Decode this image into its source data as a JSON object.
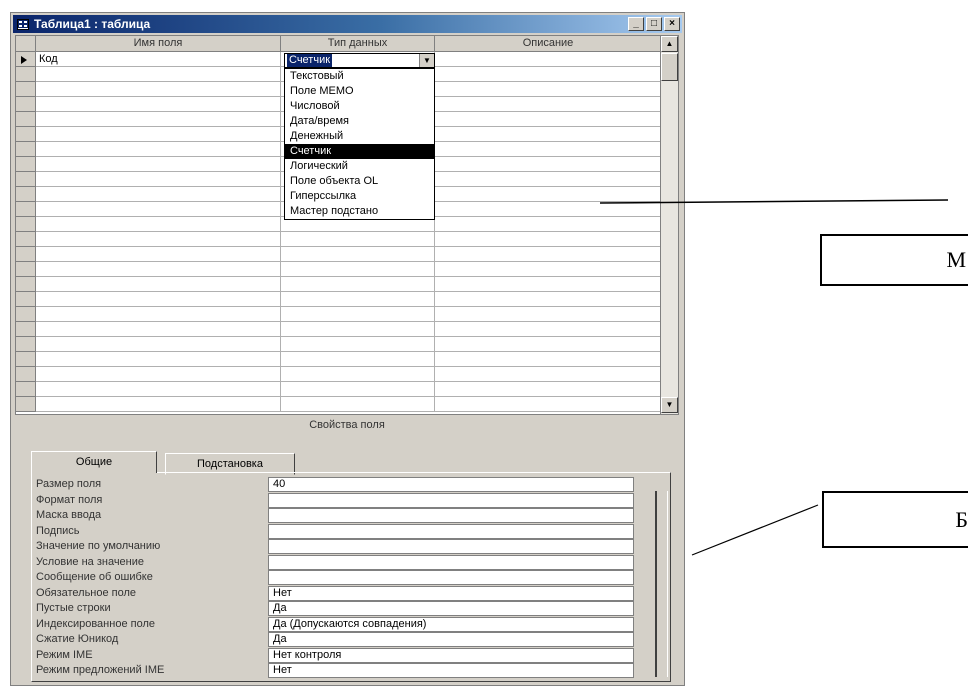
{
  "window": {
    "title": "Таблица1 : таблица"
  },
  "grid": {
    "columns": [
      "Имя поля",
      "Тип данных",
      "Описание"
    ],
    "first_row": {
      "field_name": "Код",
      "data_type": "Счетчик"
    },
    "row_count": 24
  },
  "dropdown": {
    "items": [
      "Текстовый",
      "Поле MEMO",
      "Числовой",
      "Дата/время",
      "Денежный",
      "Счетчик",
      "Логический",
      "Поле объекта OL",
      "Гиперссылка",
      "Мастер подстано"
    ],
    "selected_index": 5
  },
  "properties": {
    "title": "Свойства поля",
    "tabs": [
      "Общие",
      "Подстановка"
    ],
    "active_tab": 0,
    "rows": [
      {
        "label": "Размер поля",
        "value": "40"
      },
      {
        "label": "Формат поля",
        "value": ""
      },
      {
        "label": "Маска ввода",
        "value": ""
      },
      {
        "label": "Подпись",
        "value": ""
      },
      {
        "label": "Значение по умолчанию",
        "value": ""
      },
      {
        "label": "Условие на значение",
        "value": ""
      },
      {
        "label": "Сообщение об ошибке",
        "value": ""
      },
      {
        "label": "Обязательное поле",
        "value": "Нет"
      },
      {
        "label": "Пустые строки",
        "value": "Да"
      },
      {
        "label": "Индексированное поле",
        "value": "Да (Допускаются совпадения)"
      },
      {
        "label": "Сжатие Юникод",
        "value": "Да"
      },
      {
        "label": "Режим IME",
        "value": "Нет контроля"
      },
      {
        "label": "Режим предложений IME",
        "value": "Нет"
      }
    ]
  },
  "annotations": {
    "top": "М",
    "bottom": "Б"
  }
}
